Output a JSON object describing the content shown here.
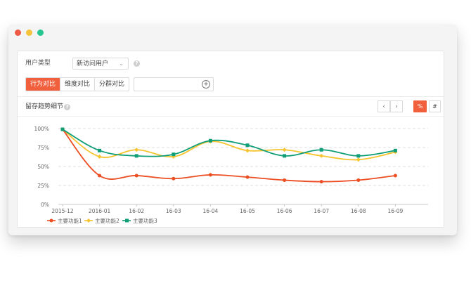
{
  "toolbar": {
    "user_type_label": "用户类型",
    "user_type_value": "新访问用户",
    "tabs": [
      {
        "label": "行为对比",
        "active": true
      },
      {
        "label": "维度对比",
        "active": false
      },
      {
        "label": "分群对比",
        "active": false
      }
    ],
    "add_input_value": ""
  },
  "section": {
    "title": "留存趋势细节",
    "prev_label": "‹",
    "next_label": "›",
    "percent_label": "%",
    "number_label": "#"
  },
  "colors": {
    "accent": "#f25f3c",
    "series1": "#ec4d22",
    "series2": "#f6c42f",
    "series3": "#0f9e78"
  },
  "chart_data": {
    "type": "line",
    "categories": [
      "2015-12",
      "2016-01",
      "16-02",
      "16-03",
      "16-04",
      "16-05",
      "16-06",
      "16-07",
      "16-08",
      "16-09"
    ],
    "y_ticks": [
      "100%",
      "75%",
      "50%",
      "25%",
      "0%"
    ],
    "ylim": [
      0,
      100
    ],
    "grid": true,
    "legend_position": "bottom-left",
    "series": [
      {
        "name": "主要功能1",
        "values": [
          99,
          38,
          38,
          34,
          39,
          36,
          32,
          30,
          32,
          38
        ]
      },
      {
        "name": "主要功能2",
        "values": [
          99,
          63,
          72,
          63,
          83,
          71,
          72,
          64,
          59,
          69
        ]
      },
      {
        "name": "主要功能3",
        "values": [
          99,
          71,
          64,
          66,
          84,
          78,
          64,
          72,
          64,
          71
        ]
      }
    ]
  }
}
